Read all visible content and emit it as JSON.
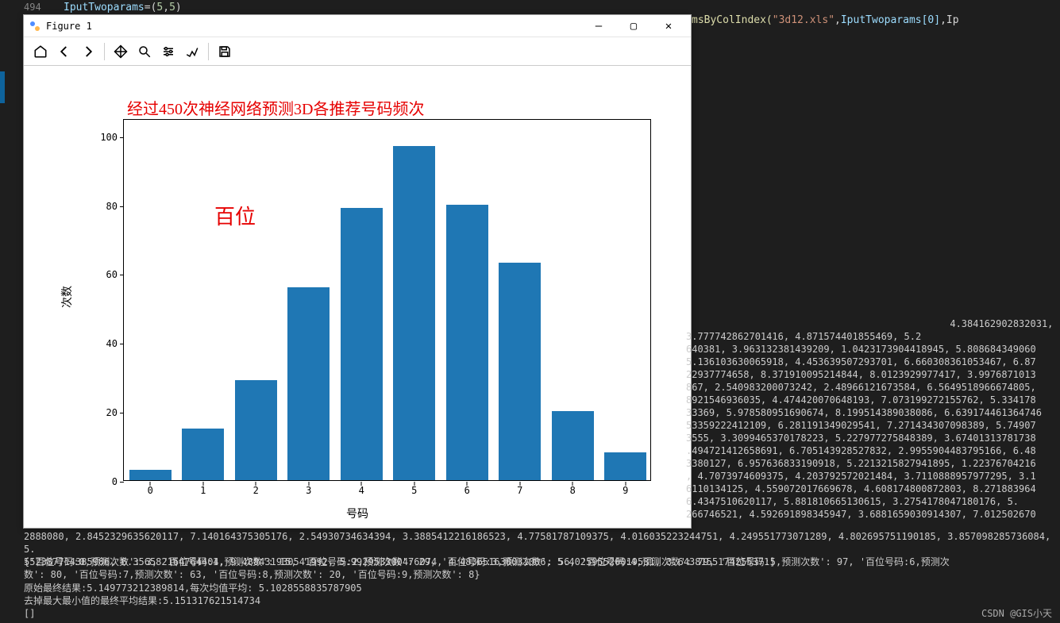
{
  "editor": {
    "line_number": "494",
    "code_var": "IputTwoparams",
    "code_assign": "=(5,5)",
    "right_fragment_prefix": "msByColIndex(",
    "right_fragment_str": "\"3d12.xls\"",
    "right_fragment_mid": ",",
    "right_fragment_var": "IputTwoparams[0]",
    "right_fragment_end": ",Ip"
  },
  "window": {
    "title": "Figure 1",
    "min": "—",
    "max": "▢",
    "close": "✕"
  },
  "chart_data": {
    "type": "bar",
    "title": "经过450次神经网络预测3D各推荐号码频次",
    "xlabel": "号码",
    "ylabel": "次数",
    "annotation": "百位",
    "categories": [
      "0",
      "1",
      "2",
      "3",
      "4",
      "5",
      "6",
      "7",
      "8",
      "9"
    ],
    "values": [
      3,
      15,
      29,
      56,
      79,
      97,
      80,
      63,
      20,
      8
    ],
    "y_ticks": [
      0,
      20,
      40,
      60,
      80,
      100
    ],
    "ylim": [
      0,
      105
    ]
  },
  "console": {
    "right_block": "                                              4.384162902832031, 3.777742862701416, 4.871574401855469, 5.2\n640381, 3.963132381439209, 1.0423173904418945, 5.808684349060\n5.136103630065918, 4.453639507293701, 6.660308361053467, 6.87\n22937774658, 8.371910095214844, 8.0123929977417, 3.9976871013\n867, 2.540983200073242, 2.48966121673584, 6.5649518966674805,\n8921546936035, 4.474420070648193, 7.073199272155762, 5.334178\n33369, 5.978580951690674, 8.199514389038086, 6.639174461364746\n53359222412109, 6.281191349029541, 7.271434307098389, 5.74907\n3555, 3.3099465370178223, 5.227977275848389, 3.67401313781738\n.494721412658691, 6.705143928527832, 2.9955904483795166, 6.48\n3380127, 6.957636833190918, 5.2213215827941895, 1.22376704216\n, 4.7073974609375, 4.203792572021484, 3.7110888957977295, 3.1\n6110134125, 4.559072017669678, 4.608174800872803, 8.271883964\n6.4347510620117, 5.881810665130615, 3.2754178047180176, 5.\n266746521, 4.592691898345947, 3.6881659030914307, 7.012502670",
    "below_block": "2888080, 2.8452329635620117, 7.140164375305176, 2.54930734634394, 3.3885412216186523, 4.77581787109375, 4.016035223244751, 4.249551773071289, 4.802695751190185, 3.857098285736084, 5.\n552387714385986, 6.356582164764404, 9.488431930541992, 5.992953300476074, 4.483651638031006, 5.402595520019531, 3.6438155174255371]",
    "dict_line": "{'百位号码:0,预测次数': 3, '百位号码:1,预测次数': 15, '百位号码:2,预测次数': 29, '百位号码:3,预测次数': 56, '百位号码:4,预测次数': 79, '百位号码:5,预测次数': 97, '百位号码:6,预测次\n数': 80, '百位号码:7,预测次数': 63, '百位号码:8,预测次数': 20, '百位号码:9,预测次数': 8}",
    "avg_line": "原始最终结果:5.149773212389814,每次均值平均: 5.1028558835787905",
    "trimmed_line": "去掉最大最小值的最终平均结果:5.151317621514734",
    "bracket": "[]"
  },
  "watermark": "CSDN @GIS小天"
}
